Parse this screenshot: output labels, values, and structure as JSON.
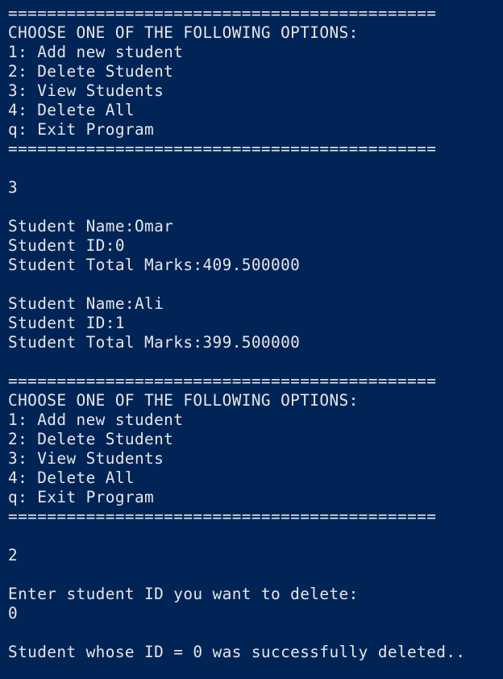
{
  "terminal": {
    "colors": {
      "background": "#012456",
      "foreground": "#E6E6E6"
    },
    "lines": [
      "============================================",
      "CHOOSE ONE OF THE FOLLOWING OPTIONS:",
      "1: Add new student",
      "2: Delete Student",
      "3: View Students",
      "4: Delete All",
      "q: Exit Program",
      "============================================",
      "",
      "3",
      "",
      "Student Name:Omar",
      "Student ID:0",
      "Student Total Marks:409.500000",
      "",
      "Student Name:Ali",
      "Student ID:1",
      "Student Total Marks:399.500000",
      "",
      "============================================",
      "CHOOSE ONE OF THE FOLLOWING OPTIONS:",
      "1: Add new student",
      "2: Delete Student",
      "3: View Students",
      "4: Delete All",
      "q: Exit Program",
      "============================================",
      "",
      "2",
      "",
      "Enter student ID you want to delete:",
      "0",
      "",
      "Student whose ID = 0 was successfully deleted.."
    ]
  }
}
